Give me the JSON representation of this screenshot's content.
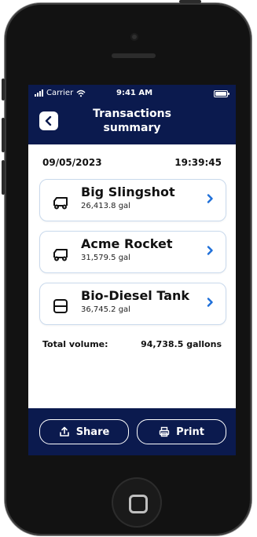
{
  "status_bar": {
    "carrier": "Carrier",
    "time": "9:41 AM"
  },
  "header": {
    "title_line1": "Transactions",
    "title_line2": "summary"
  },
  "meta": {
    "date": "09/05/2023",
    "time": "19:39:45"
  },
  "items": [
    {
      "name": "Big Slingshot",
      "volume": "26,413.8 gal",
      "icon": "truck-icon"
    },
    {
      "name": "Acme Rocket",
      "volume": "31,579.5 gal",
      "icon": "truck-icon"
    },
    {
      "name": "Bio-Diesel Tank",
      "volume": "36,745.2 gal",
      "icon": "tank-icon"
    }
  ],
  "total": {
    "label": "Total volume:",
    "value": "94,738.5 gallons"
  },
  "actions": {
    "share_label": "Share",
    "print_label": "Print"
  },
  "colors": {
    "navy": "#0b1a4e",
    "accent_blue": "#1e6fd9",
    "card_border": "#c9d9ec"
  }
}
